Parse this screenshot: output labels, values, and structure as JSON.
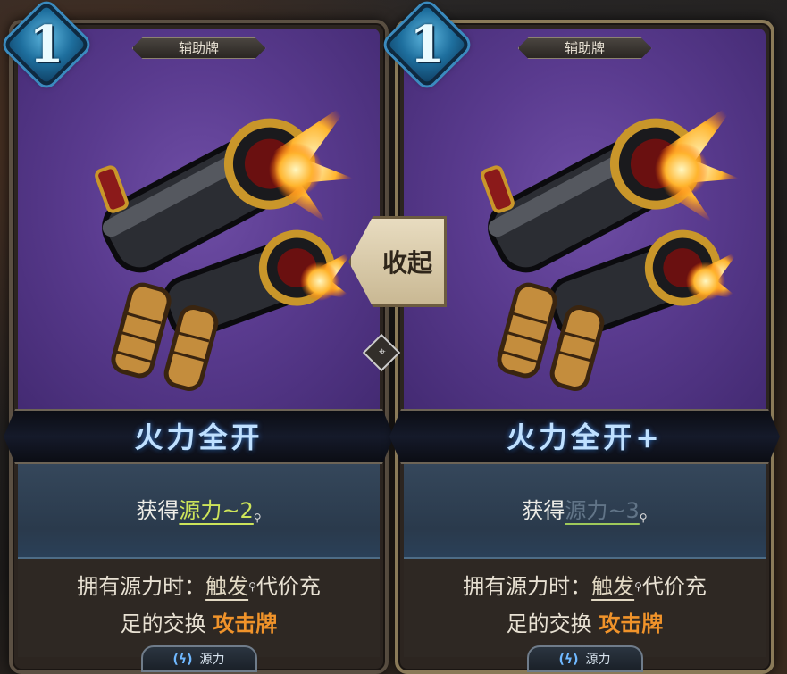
{
  "left_card": {
    "cost": "1",
    "type_tag": "辅助牌",
    "title": "火力全开",
    "effect_prefix": "获得",
    "effect_keyword": "源力~2",
    "desc_line1_prefix": "拥有源力时：",
    "desc_line1_keyword": "触发",
    "desc_line1_suffix": "代价充",
    "desc_line2_prefix": "足的交换 ",
    "desc_line2_keyword": "攻击牌",
    "tag_label": "源力"
  },
  "right_card": {
    "cost": "1",
    "type_tag": "辅助牌",
    "title": "火力全开+",
    "effect_prefix": "获得",
    "effect_keyword": "源力~3",
    "desc_line1_prefix": "拥有源力时：",
    "desc_line1_keyword": "触发",
    "desc_line1_suffix": "代价充",
    "desc_line2_prefix": "足的交换 ",
    "desc_line2_keyword": "攻击牌",
    "tag_label": "源力"
  },
  "collapse_button_label": "收起",
  "icons": {
    "gun": "double-barrel-pistol-icon",
    "magnifier": "magnifier-icon",
    "energy": "energy-icon",
    "tooltip": "tooltip-icon"
  },
  "colors": {
    "art_bg": "#5a3b8f",
    "cost_badge": "#1e6f9e",
    "keyword_green": "#cde45a",
    "keyword_orange": "#f0932a",
    "title_glow": "#bfe0ff"
  }
}
